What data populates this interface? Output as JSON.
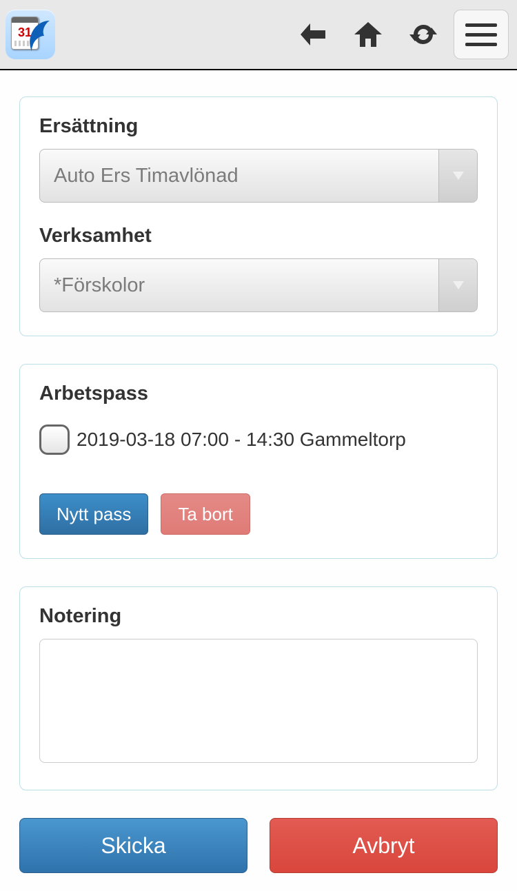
{
  "logo": {
    "calendar_number": "31"
  },
  "form": {
    "ersattning": {
      "label": "Ersättning",
      "value": "Auto Ers Timavlönad"
    },
    "verksamhet": {
      "label": "Verksamhet",
      "value": "*Förskolor"
    },
    "arbetspass": {
      "label": "Arbetspass",
      "items": [
        {
          "text": "2019-03-18 07:00 - 14:30 Gammeltorp",
          "checked": false
        }
      ],
      "buttons": {
        "new": "Nytt pass",
        "delete": "Ta bort"
      }
    },
    "notering": {
      "label": "Notering",
      "value": ""
    }
  },
  "actions": {
    "submit": "Skicka",
    "cancel": "Avbryt"
  }
}
